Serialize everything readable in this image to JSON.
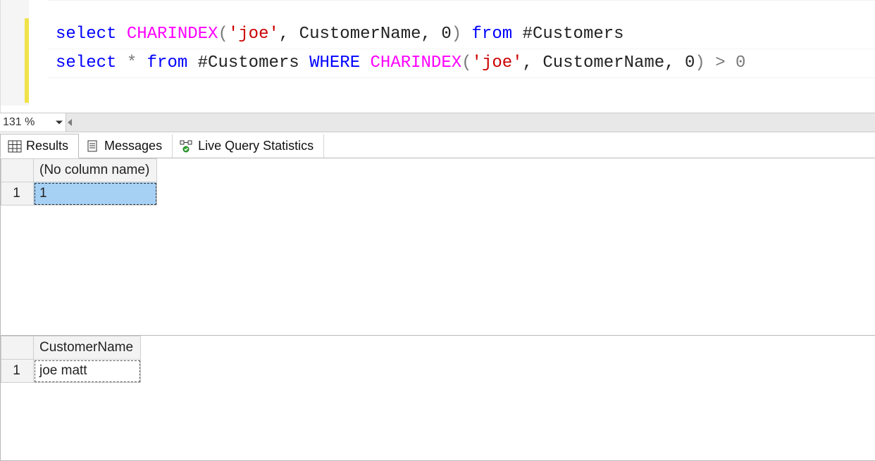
{
  "editor": {
    "lines": [
      [
        {
          "t": "select ",
          "c": "kw"
        },
        {
          "t": "CHARINDEX",
          "c": "fn"
        },
        {
          "t": "(",
          "c": "gry"
        },
        {
          "t": "'joe'",
          "c": "str"
        },
        {
          "t": ", CustomerName, 0",
          "c": ""
        },
        {
          "t": ")",
          "c": "gry"
        },
        {
          "t": " from ",
          "c": "kw"
        },
        {
          "t": "#Customers",
          "c": ""
        }
      ],
      [
        {
          "t": "select ",
          "c": "kw"
        },
        {
          "t": "*",
          "c": "gry"
        },
        {
          "t": " from ",
          "c": "kw"
        },
        {
          "t": "#Customers ",
          "c": ""
        },
        {
          "t": "WHERE ",
          "c": "kw"
        },
        {
          "t": "CHARINDEX",
          "c": "fn"
        },
        {
          "t": "(",
          "c": "gry"
        },
        {
          "t": "'joe'",
          "c": "str"
        },
        {
          "t": ", CustomerName, 0",
          "c": ""
        },
        {
          "t": ")",
          "c": "gry"
        },
        {
          "t": " > 0",
          "c": "gry"
        }
      ]
    ]
  },
  "zoom": {
    "value": "131 %"
  },
  "tabs": {
    "results": "Results",
    "messages": "Messages",
    "live": "Live Query Statistics"
  },
  "result1": {
    "header": "(No column name)",
    "rownum": "1",
    "value": "1"
  },
  "result2": {
    "header": "CustomerName",
    "rownum": "1",
    "value": "joe matt"
  }
}
